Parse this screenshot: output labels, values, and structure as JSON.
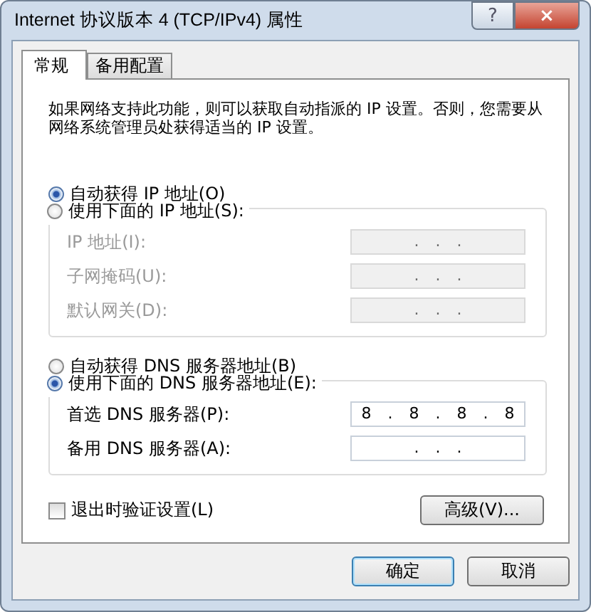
{
  "window": {
    "title": "Internet 协议版本 4 (TCP/IPv4) 属性",
    "help": "?",
    "close": "×"
  },
  "tabs": [
    {
      "label": "常规",
      "selected": true
    },
    {
      "label": "备用配置",
      "selected": false
    }
  ],
  "description": "如果网络支持此功能，则可以获取自动指派的 IP 设置。否则，您需要从网络系统管理员处获得适当的 IP 设置。",
  "groups": [
    {
      "auto": {
        "label": "自动获得 IP 地址(O)",
        "selected": true
      },
      "manual": {
        "label": "使用下面的 IP 地址(S):",
        "selected": false
      },
      "fields": [
        {
          "label": "IP 地址(I):",
          "value": ". . .",
          "disabled": true
        },
        {
          "label": "子网掩码(U):",
          "value": ". . .",
          "disabled": true
        },
        {
          "label": "默认网关(D):",
          "value": ". . .",
          "disabled": true
        }
      ]
    },
    {
      "auto": {
        "label": "自动获得 DNS 服务器地址(B)",
        "selected": false
      },
      "manual": {
        "label": "使用下面的 DNS 服务器地址(E):",
        "selected": true
      },
      "fields": [
        {
          "label": "首选 DNS 服务器(P):",
          "value": "8 . 8 . 8 . 8",
          "disabled": false
        },
        {
          "label": "备用 DNS 服务器(A):",
          "value": ". . .",
          "disabled": false
        }
      ]
    }
  ],
  "validate": {
    "label": "退出时验证设置(L)",
    "checked": false
  },
  "advanced": "高级(V)...",
  "buttons": [
    {
      "label": "确定",
      "default": true
    },
    {
      "label": "取消",
      "default": false
    }
  ]
}
